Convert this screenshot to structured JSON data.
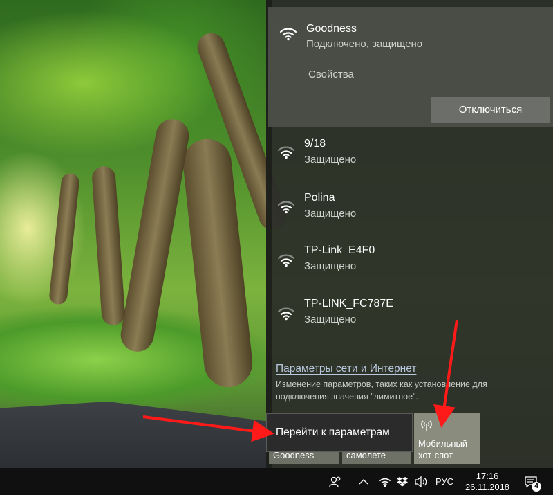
{
  "wifi_flyout": {
    "connected_network": {
      "name": "Goodness",
      "status": "Подключено, защищено",
      "properties_link": "Свойства",
      "disconnect_button": "Отключиться"
    },
    "networks": [
      {
        "name": "9/18",
        "status": "Защищено"
      },
      {
        "name": "Polina",
        "status": "Защищено"
      },
      {
        "name": "TP-Link_E4F0",
        "status": "Защищено"
      },
      {
        "name": "TP-LINK_FC787E",
        "status": "Защищено"
      }
    ],
    "settings_link": "Параметры сети и Интернет",
    "settings_description": "Изменение параметров, таких как установление для подключения значения \"лимитное\".",
    "quick_tiles": [
      {
        "label": "Goodness",
        "icon": "wifi-icon"
      },
      {
        "label": "самолете",
        "icon": "airplane-icon"
      },
      {
        "label": "Мобильный хот-спот",
        "icon": "hotspot-icon"
      }
    ],
    "tooltip": "Перейти к параметрам"
  },
  "taskbar": {
    "language": "РУС",
    "time": "17:16",
    "date": "26.11.2018",
    "notification_count": "4",
    "tray_icons": [
      "people-icon",
      "chevron-up-icon",
      "wifi-icon",
      "dropbox-icon",
      "volume-icon",
      "action-center-icon"
    ]
  },
  "colors": {
    "flyout_bg": "#2c2e28",
    "connected_bg": "#4a4d46",
    "annotation_arrow": "#ff1a1a",
    "link_blue": "#b8c8de"
  }
}
